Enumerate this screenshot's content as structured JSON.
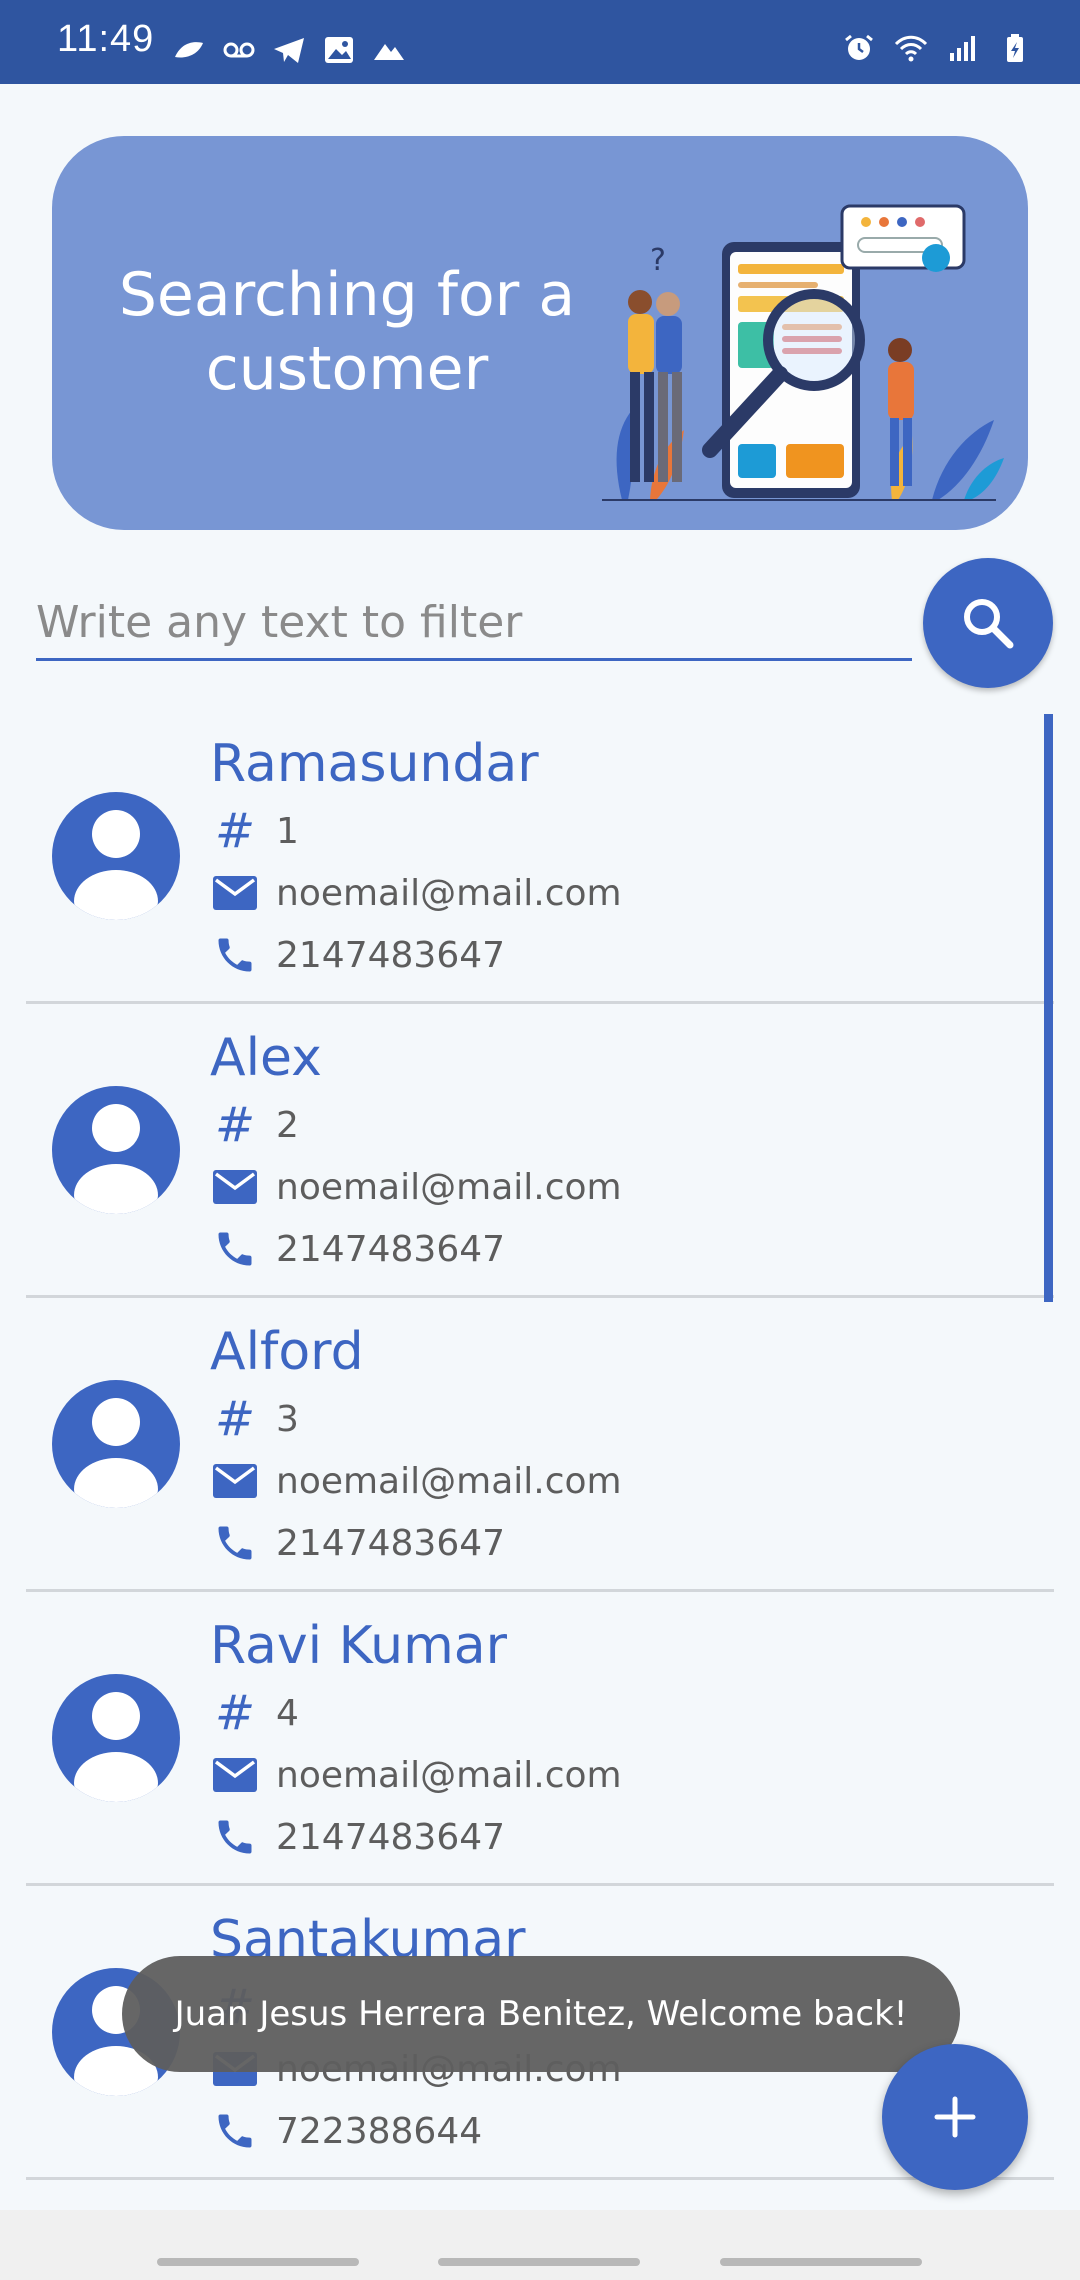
{
  "status_bar": {
    "time": "11:49",
    "left_icons": [
      "leaf-icon",
      "voicemail-icon",
      "telegram-icon",
      "image-icon",
      "mountain-icon"
    ],
    "right_icons": [
      "alarm-icon",
      "wifi-icon",
      "signal-icon",
      "battery-icon"
    ]
  },
  "banner": {
    "title": "Searching for a customer"
  },
  "search": {
    "placeholder": "Write any text to filter",
    "value": ""
  },
  "customers": [
    {
      "name": "Ramasundar",
      "id": "1",
      "email": "noemail@mail.com",
      "phone": "2147483647"
    },
    {
      "name": "Alex",
      "id": "2",
      "email": "noemail@mail.com",
      "phone": "2147483647"
    },
    {
      "name": "Alford",
      "id": "3",
      "email": "noemail@mail.com",
      "phone": "2147483647"
    },
    {
      "name": "Ravi Kumar",
      "id": "4",
      "email": "noemail@mail.com",
      "phone": "2147483647"
    },
    {
      "name": "Santakumar",
      "id": "",
      "email": "noemail@mail.com",
      "phone": "722388644"
    }
  ],
  "toast": {
    "message": "Juan Jesus Herrera Benitez, Welcome back!"
  },
  "colors": {
    "accent": "#3d66c2",
    "status_bar": "#2f55a0",
    "banner": "#7896d4"
  }
}
